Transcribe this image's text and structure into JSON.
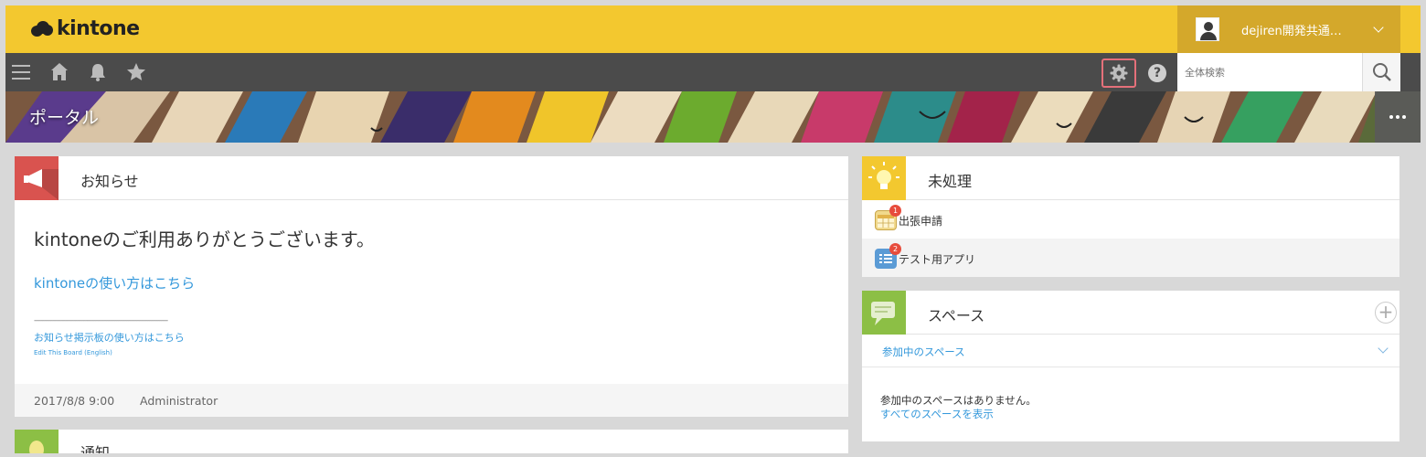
{
  "header": {
    "logo_text": "kintone",
    "brand_color": "#f3c82f",
    "user_name": "dejiren開発共通…"
  },
  "toolbar": {
    "icons": [
      "menu-icon",
      "home-icon",
      "bell-icon",
      "star-icon",
      "gear-icon",
      "help-icon"
    ],
    "help_label": "?",
    "search_placeholder": "全体検索"
  },
  "portal": {
    "title": "ポータル"
  },
  "notice": {
    "title": "お知らせ",
    "welcome": "kintoneのご利用ありがとうございます。",
    "howto_link": "kintoneの使い方はこちら",
    "separator": "-----------------------------------------------------------------",
    "board_howto_link": "お知らせ掲示板の使い方はこちら",
    "edit_board_link": "Edit This Board (English)",
    "date": "2017/8/8 9:00",
    "author": "Administrator"
  },
  "notifications": {
    "title": "通知"
  },
  "pending": {
    "title": "未処理",
    "items": [
      {
        "label": "出張申請",
        "badge": "1"
      },
      {
        "label": "テスト用アプリ",
        "badge": "2"
      }
    ]
  },
  "space": {
    "title": "スペース",
    "add_label": "+",
    "joined_label": "参加中のスペース",
    "empty_message": "参加中のスペースはありません。",
    "show_all_link": "すべてのスペースを表示"
  }
}
